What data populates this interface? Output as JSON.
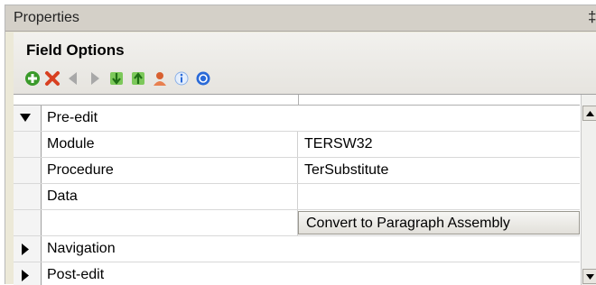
{
  "panel": {
    "title": "Properties",
    "pin_glyph": "‡"
  },
  "section": {
    "title": "Field Options"
  },
  "toolbar": {
    "buttons": [
      {
        "name": "add-icon",
        "color": "#3a9a2a"
      },
      {
        "name": "delete-icon",
        "color": "#d84020"
      },
      {
        "name": "move-left-icon",
        "color": "#a8a8a8"
      },
      {
        "name": "move-right-icon",
        "color": "#a8a8a8"
      },
      {
        "name": "move-down-icon",
        "color": "#3a9a2a"
      },
      {
        "name": "move-up-icon",
        "color": "#3a9a2a"
      },
      {
        "name": "user-icon",
        "color": "#d86030"
      },
      {
        "name": "info-icon",
        "color": "#2a6ad8"
      },
      {
        "name": "help-icon",
        "color": "#2a6ad8"
      }
    ]
  },
  "grid": {
    "rows": [
      {
        "type": "group",
        "expanded": true,
        "label": "Pre-edit"
      },
      {
        "type": "property",
        "label": "Module",
        "value": "TERSW32"
      },
      {
        "type": "property",
        "label": "Procedure",
        "value": "TerSubstitute"
      },
      {
        "type": "property",
        "label": "Data",
        "value": ""
      },
      {
        "type": "action",
        "label": "",
        "button_label": "Convert to Paragraph Assembly"
      },
      {
        "type": "group",
        "expanded": false,
        "label": "Navigation"
      },
      {
        "type": "group",
        "expanded": false,
        "label": "Post-edit"
      }
    ]
  }
}
